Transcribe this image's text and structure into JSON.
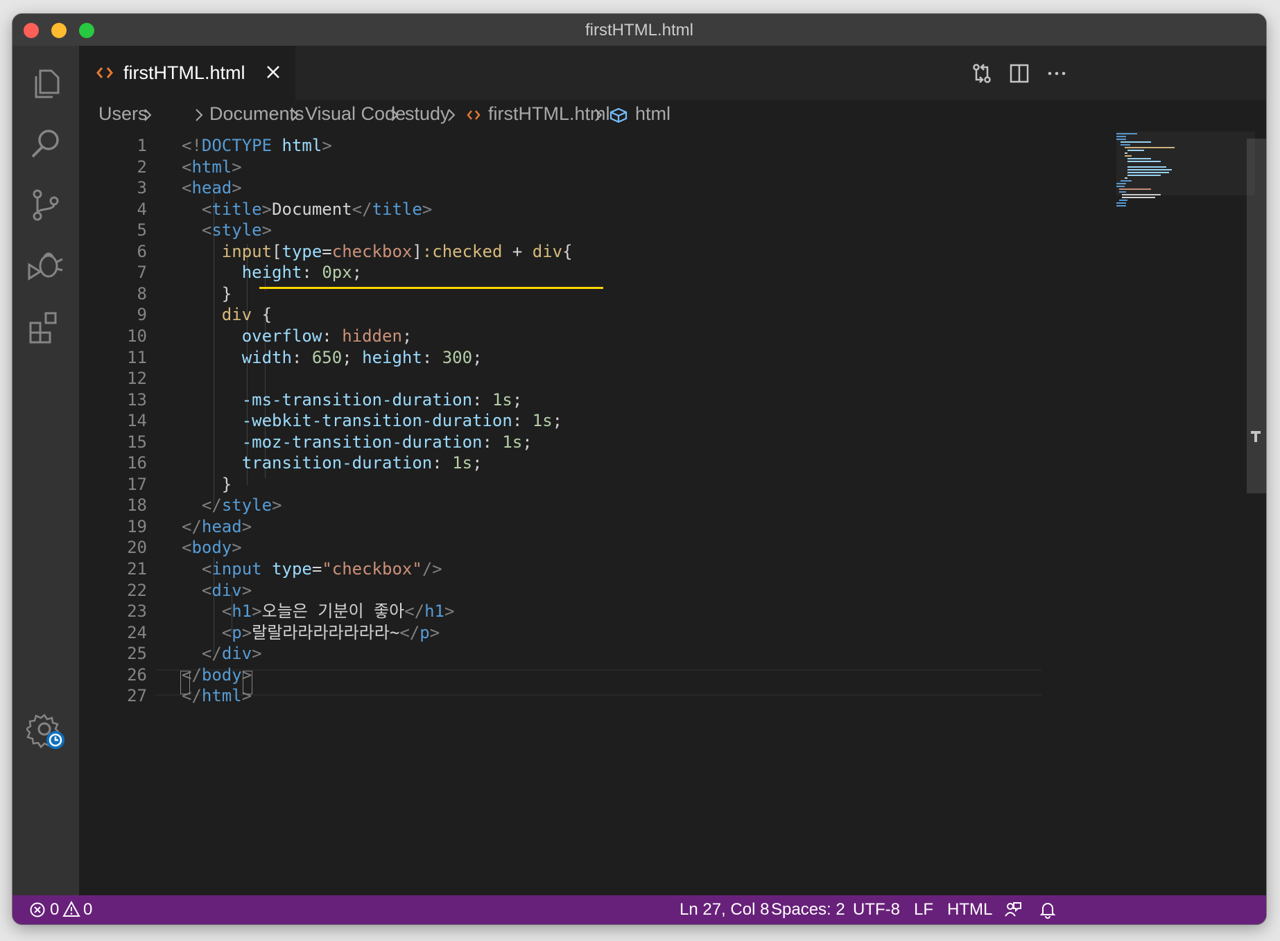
{
  "window": {
    "title": "firstHTML.html"
  },
  "tab": {
    "label": "firstHTML.html"
  },
  "breadcrumb": {
    "segments": [
      "Users",
      "Documents",
      "Visual Code",
      "study",
      "firstHTML.html",
      "html"
    ]
  },
  "editor": {
    "line_numbers": [
      "1",
      "2",
      "3",
      "4",
      "5",
      "6",
      "7",
      "8",
      "9",
      "10",
      "11",
      "12",
      "13",
      "14",
      "15",
      "16",
      "17",
      "18",
      "19",
      "20",
      "21",
      "22",
      "23",
      "24",
      "25",
      "26",
      "27"
    ],
    "lines": [
      "<!DOCTYPE html>",
      "<html>",
      "<head>",
      "  <title>Document</title>",
      "  <style>",
      "    input[type=checkbox]:checked + div{",
      "      height: 0px;",
      "    }",
      "    div {",
      "      overflow: hidden;",
      "      width: 650; height: 300;",
      "",
      "      -ms-transition-duration: 1s;",
      "      -webkit-transition-duration: 1s;",
      "      -moz-transition-duration: 1s;",
      "      transition-duration: 1s;",
      "    }",
      "  </style>",
      "</head>",
      "<body>",
      "  <input type=\"checkbox\"/>",
      "  <div>",
      "    <h1>오늘은 기분이 좋아</h1>",
      "    <p>랄랄라라라라라라라~</p>",
      "  </div>",
      "</body>",
      "</html>"
    ],
    "cursor_line": 27,
    "warning_line": 6
  },
  "status": {
    "errors": "0",
    "warnings": "0",
    "position": "Ln 27, Col 8",
    "spaces": "Spaces: 2",
    "encoding": "UTF-8",
    "eol": "LF",
    "language": "HTML"
  },
  "theme": {
    "status_bar_color": "#68217a",
    "editor_bg": "#1e1e1e",
    "activity_bar_bg": "#333333",
    "html_icon_color": "#e37933",
    "squiggle_color": "#ffd700"
  },
  "icons": {
    "activity": [
      "explorer-icon",
      "search-icon",
      "source-control-icon",
      "debug-icon",
      "extensions-icon",
      "manage-gear-icon"
    ],
    "tab": [
      "html-file-icon",
      "close-icon"
    ],
    "actions": [
      "open-changes-icon",
      "split-editor-icon",
      "more-actions-icon"
    ],
    "status": [
      "error-icon",
      "warning-icon",
      "feedback-icon",
      "bell-icon"
    ]
  }
}
